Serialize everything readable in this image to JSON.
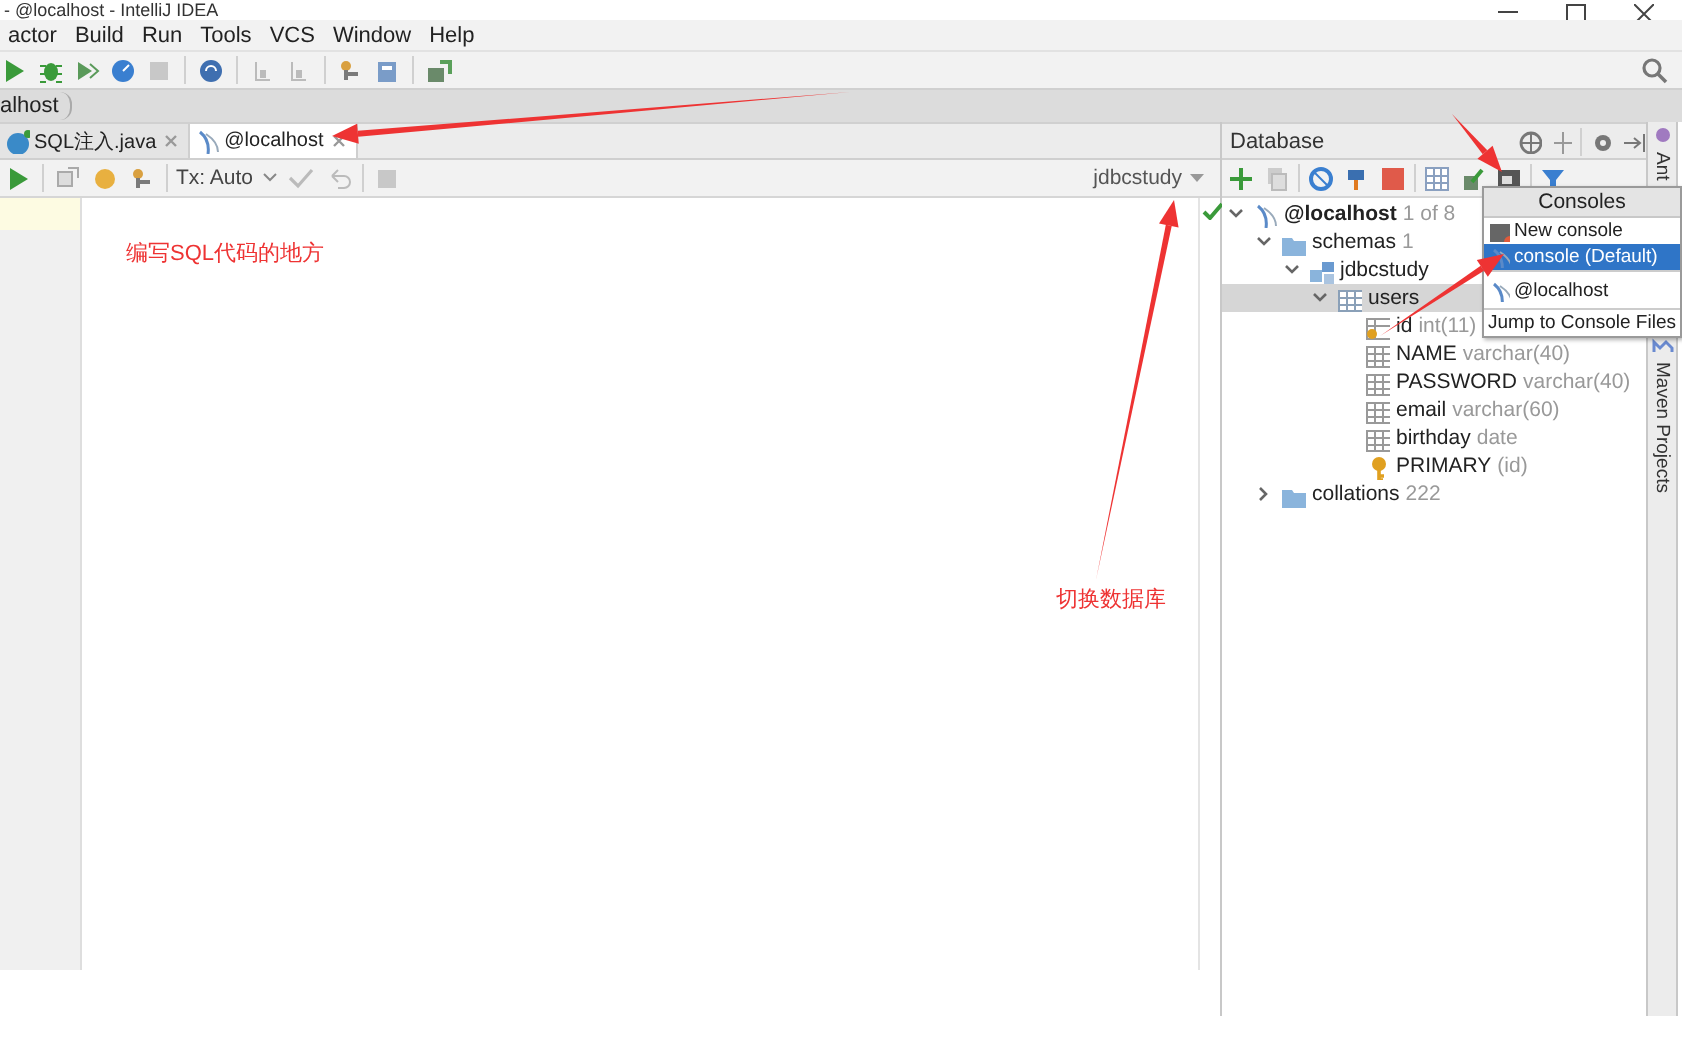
{
  "window": {
    "title": "- @localhost - IntelliJ IDEA"
  },
  "menu": [
    "actor",
    "Build",
    "Run",
    "Tools",
    "VCS",
    "Window",
    "Help"
  ],
  "breadcrumb": "alhost",
  "tabs": [
    {
      "label": "SQL注入.java",
      "kind": "java",
      "selected": false
    },
    {
      "label": "@localhost",
      "kind": "console",
      "selected": true
    }
  ],
  "editor_toolbar": {
    "tx_mode": "Tx: Auto",
    "schema": "jdbcstudy"
  },
  "database": {
    "title": "Database",
    "tree": [
      {
        "label": "@localhost",
        "detail": "1 of 8",
        "kind": "datasource",
        "expanded": true,
        "selected": false,
        "children": [
          {
            "label": "schemas",
            "detail": "1",
            "kind": "folder",
            "expanded": true,
            "selected": false,
            "children": [
              {
                "label": "jdbcstudy",
                "kind": "schema",
                "expanded": true,
                "selected": false,
                "children": [
                  {
                    "label": "users",
                    "kind": "table",
                    "expanded": true,
                    "selected": true,
                    "children": [
                      {
                        "label": "id",
                        "detail": "int(11)",
                        "kind": "pk-column",
                        "selected": false
                      },
                      {
                        "label": "NAME",
                        "detail": "varchar(40)",
                        "kind": "column",
                        "selected": false
                      },
                      {
                        "label": "PASSWORD",
                        "detail": "varchar(40)",
                        "kind": "column",
                        "selected": false
                      },
                      {
                        "label": "email",
                        "detail": "varchar(60)",
                        "kind": "column",
                        "selected": false
                      },
                      {
                        "label": "birthday",
                        "detail": "date",
                        "kind": "column",
                        "selected": false
                      },
                      {
                        "label": "PRIMARY",
                        "detail": "(id)",
                        "kind": "key",
                        "selected": false
                      }
                    ]
                  }
                ]
              }
            ]
          },
          {
            "label": "collations",
            "detail": "222",
            "kind": "folder",
            "expanded": false,
            "selected": false
          }
        ]
      }
    ]
  },
  "consoles_popup": {
    "title": "Consoles",
    "items": [
      {
        "label": "New console",
        "kind": "new",
        "selected": false
      },
      {
        "label": "console (Default)",
        "kind": "console",
        "selected": true
      },
      {
        "label": "@localhost",
        "kind": "datasource",
        "selected": false
      },
      {
        "label": "Jump to Console Files",
        "kind": "action",
        "selected": false
      }
    ]
  },
  "side_tabs": [
    "Ant",
    "Maven Projects"
  ],
  "annotations": [
    {
      "text": "编写SQL代码的地方",
      "kind": "label"
    },
    {
      "text": "切换数据库",
      "kind": "label"
    }
  ]
}
